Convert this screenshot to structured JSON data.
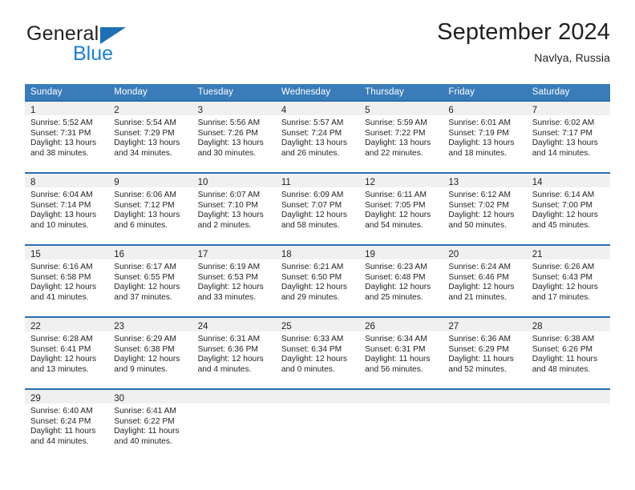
{
  "brand": {
    "name_part1": "General",
    "name_part2": "Blue",
    "triangle_color": "#1f6fb5",
    "blue_text_color": "#1b7fd4"
  },
  "header": {
    "title": "September 2024",
    "subtitle": "Navlya, Russia"
  },
  "theme": {
    "header_row_bg": "#3a7cb9",
    "cell_top_border": "#2a6db0",
    "daynum_band_bg": "#f0f0f0",
    "text_color": "#231f20"
  },
  "calendar": {
    "weekday_headers": [
      "Sunday",
      "Monday",
      "Tuesday",
      "Wednesday",
      "Thursday",
      "Friday",
      "Saturday"
    ],
    "weeks": [
      [
        {
          "day": "1",
          "sunrise": "Sunrise: 5:52 AM",
          "sunset": "Sunset: 7:31 PM",
          "daylight_1": "Daylight: 13 hours",
          "daylight_2": "and 38 minutes."
        },
        {
          "day": "2",
          "sunrise": "Sunrise: 5:54 AM",
          "sunset": "Sunset: 7:29 PM",
          "daylight_1": "Daylight: 13 hours",
          "daylight_2": "and 34 minutes."
        },
        {
          "day": "3",
          "sunrise": "Sunrise: 5:56 AM",
          "sunset": "Sunset: 7:26 PM",
          "daylight_1": "Daylight: 13 hours",
          "daylight_2": "and 30 minutes."
        },
        {
          "day": "4",
          "sunrise": "Sunrise: 5:57 AM",
          "sunset": "Sunset: 7:24 PM",
          "daylight_1": "Daylight: 13 hours",
          "daylight_2": "and 26 minutes."
        },
        {
          "day": "5",
          "sunrise": "Sunrise: 5:59 AM",
          "sunset": "Sunset: 7:22 PM",
          "daylight_1": "Daylight: 13 hours",
          "daylight_2": "and 22 minutes."
        },
        {
          "day": "6",
          "sunrise": "Sunrise: 6:01 AM",
          "sunset": "Sunset: 7:19 PM",
          "daylight_1": "Daylight: 13 hours",
          "daylight_2": "and 18 minutes."
        },
        {
          "day": "7",
          "sunrise": "Sunrise: 6:02 AM",
          "sunset": "Sunset: 7:17 PM",
          "daylight_1": "Daylight: 13 hours",
          "daylight_2": "and 14 minutes."
        }
      ],
      [
        {
          "day": "8",
          "sunrise": "Sunrise: 6:04 AM",
          "sunset": "Sunset: 7:14 PM",
          "daylight_1": "Daylight: 13 hours",
          "daylight_2": "and 10 minutes."
        },
        {
          "day": "9",
          "sunrise": "Sunrise: 6:06 AM",
          "sunset": "Sunset: 7:12 PM",
          "daylight_1": "Daylight: 13 hours",
          "daylight_2": "and 6 minutes."
        },
        {
          "day": "10",
          "sunrise": "Sunrise: 6:07 AM",
          "sunset": "Sunset: 7:10 PM",
          "daylight_1": "Daylight: 13 hours",
          "daylight_2": "and 2 minutes."
        },
        {
          "day": "11",
          "sunrise": "Sunrise: 6:09 AM",
          "sunset": "Sunset: 7:07 PM",
          "daylight_1": "Daylight: 12 hours",
          "daylight_2": "and 58 minutes."
        },
        {
          "day": "12",
          "sunrise": "Sunrise: 6:11 AM",
          "sunset": "Sunset: 7:05 PM",
          "daylight_1": "Daylight: 12 hours",
          "daylight_2": "and 54 minutes."
        },
        {
          "day": "13",
          "sunrise": "Sunrise: 6:12 AM",
          "sunset": "Sunset: 7:02 PM",
          "daylight_1": "Daylight: 12 hours",
          "daylight_2": "and 50 minutes."
        },
        {
          "day": "14",
          "sunrise": "Sunrise: 6:14 AM",
          "sunset": "Sunset: 7:00 PM",
          "daylight_1": "Daylight: 12 hours",
          "daylight_2": "and 45 minutes."
        }
      ],
      [
        {
          "day": "15",
          "sunrise": "Sunrise: 6:16 AM",
          "sunset": "Sunset: 6:58 PM",
          "daylight_1": "Daylight: 12 hours",
          "daylight_2": "and 41 minutes."
        },
        {
          "day": "16",
          "sunrise": "Sunrise: 6:17 AM",
          "sunset": "Sunset: 6:55 PM",
          "daylight_1": "Daylight: 12 hours",
          "daylight_2": "and 37 minutes."
        },
        {
          "day": "17",
          "sunrise": "Sunrise: 6:19 AM",
          "sunset": "Sunset: 6:53 PM",
          "daylight_1": "Daylight: 12 hours",
          "daylight_2": "and 33 minutes."
        },
        {
          "day": "18",
          "sunrise": "Sunrise: 6:21 AM",
          "sunset": "Sunset: 6:50 PM",
          "daylight_1": "Daylight: 12 hours",
          "daylight_2": "and 29 minutes."
        },
        {
          "day": "19",
          "sunrise": "Sunrise: 6:23 AM",
          "sunset": "Sunset: 6:48 PM",
          "daylight_1": "Daylight: 12 hours",
          "daylight_2": "and 25 minutes."
        },
        {
          "day": "20",
          "sunrise": "Sunrise: 6:24 AM",
          "sunset": "Sunset: 6:46 PM",
          "daylight_1": "Daylight: 12 hours",
          "daylight_2": "and 21 minutes."
        },
        {
          "day": "21",
          "sunrise": "Sunrise: 6:26 AM",
          "sunset": "Sunset: 6:43 PM",
          "daylight_1": "Daylight: 12 hours",
          "daylight_2": "and 17 minutes."
        }
      ],
      [
        {
          "day": "22",
          "sunrise": "Sunrise: 6:28 AM",
          "sunset": "Sunset: 6:41 PM",
          "daylight_1": "Daylight: 12 hours",
          "daylight_2": "and 13 minutes."
        },
        {
          "day": "23",
          "sunrise": "Sunrise: 6:29 AM",
          "sunset": "Sunset: 6:38 PM",
          "daylight_1": "Daylight: 12 hours",
          "daylight_2": "and 9 minutes."
        },
        {
          "day": "24",
          "sunrise": "Sunrise: 6:31 AM",
          "sunset": "Sunset: 6:36 PM",
          "daylight_1": "Daylight: 12 hours",
          "daylight_2": "and 4 minutes."
        },
        {
          "day": "25",
          "sunrise": "Sunrise: 6:33 AM",
          "sunset": "Sunset: 6:34 PM",
          "daylight_1": "Daylight: 12 hours",
          "daylight_2": "and 0 minutes."
        },
        {
          "day": "26",
          "sunrise": "Sunrise: 6:34 AM",
          "sunset": "Sunset: 6:31 PM",
          "daylight_1": "Daylight: 11 hours",
          "daylight_2": "and 56 minutes."
        },
        {
          "day": "27",
          "sunrise": "Sunrise: 6:36 AM",
          "sunset": "Sunset: 6:29 PM",
          "daylight_1": "Daylight: 11 hours",
          "daylight_2": "and 52 minutes."
        },
        {
          "day": "28",
          "sunrise": "Sunrise: 6:38 AM",
          "sunset": "Sunset: 6:26 PM",
          "daylight_1": "Daylight: 11 hours",
          "daylight_2": "and 48 minutes."
        }
      ],
      [
        {
          "day": "29",
          "sunrise": "Sunrise: 6:40 AM",
          "sunset": "Sunset: 6:24 PM",
          "daylight_1": "Daylight: 11 hours",
          "daylight_2": "and 44 minutes."
        },
        {
          "day": "30",
          "sunrise": "Sunrise: 6:41 AM",
          "sunset": "Sunset: 6:22 PM",
          "daylight_1": "Daylight: 11 hours",
          "daylight_2": "and 40 minutes."
        },
        {
          "day": "",
          "sunrise": "",
          "sunset": "",
          "daylight_1": "",
          "daylight_2": ""
        },
        {
          "day": "",
          "sunrise": "",
          "sunset": "",
          "daylight_1": "",
          "daylight_2": ""
        },
        {
          "day": "",
          "sunrise": "",
          "sunset": "",
          "daylight_1": "",
          "daylight_2": ""
        },
        {
          "day": "",
          "sunrise": "",
          "sunset": "",
          "daylight_1": "",
          "daylight_2": ""
        },
        {
          "day": "",
          "sunrise": "",
          "sunset": "",
          "daylight_1": "",
          "daylight_2": ""
        }
      ]
    ]
  }
}
